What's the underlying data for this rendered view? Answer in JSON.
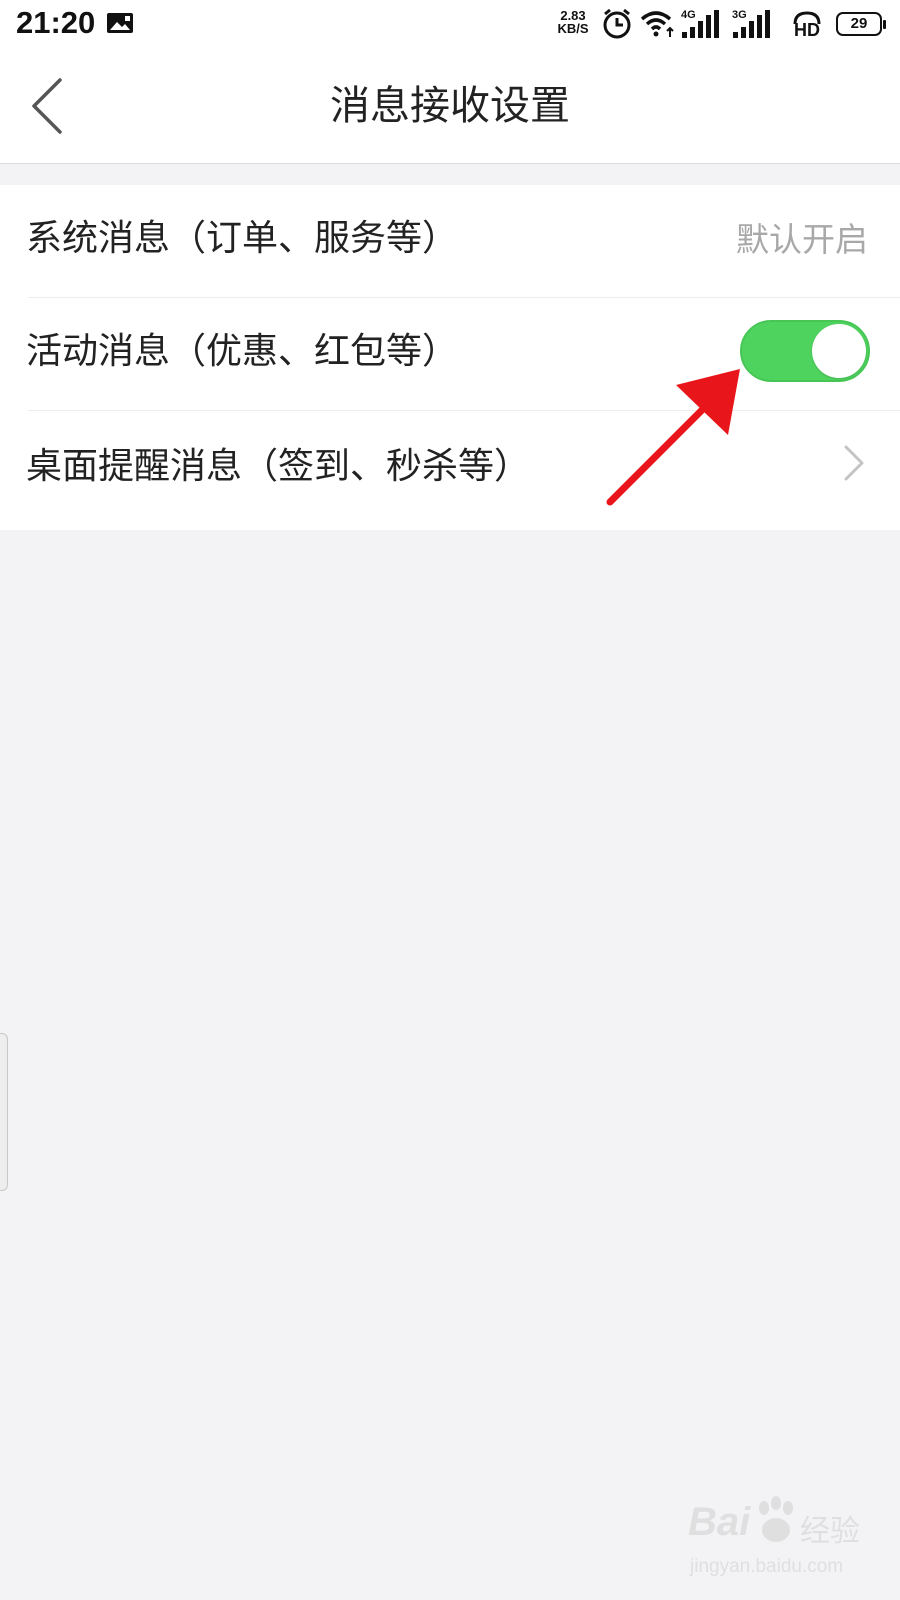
{
  "status_bar": {
    "time": "21:20",
    "net_speed_value": "2.83",
    "net_speed_unit": "KB/S",
    "network_1": "4G",
    "network_2": "3G",
    "hd": "HD",
    "battery_level": "29",
    "icons": [
      "image-icon",
      "alarm-icon",
      "wifi-icon",
      "signal-4g-icon",
      "signal-3g-icon",
      "hd-icon",
      "battery-icon"
    ]
  },
  "header": {
    "back_icon": "back-chevron-icon",
    "title": "消息接收设置"
  },
  "settings": {
    "items": [
      {
        "label": "系统消息（订单、服务等）",
        "value": "默认开启"
      },
      {
        "label": "活动消息（优惠、红包等）",
        "toggle_on": true
      },
      {
        "label": "桌面提醒消息（签到、秒杀等）",
        "icon": "chevron-right-icon"
      }
    ]
  },
  "colors": {
    "toggle_on": "#4fd35f",
    "background": "#f3f2f5",
    "annotation_arrow": "#e8161b"
  },
  "watermark": {
    "brand": "Bai",
    "cn": "经验",
    "url": "jingyan.baidu.com"
  }
}
